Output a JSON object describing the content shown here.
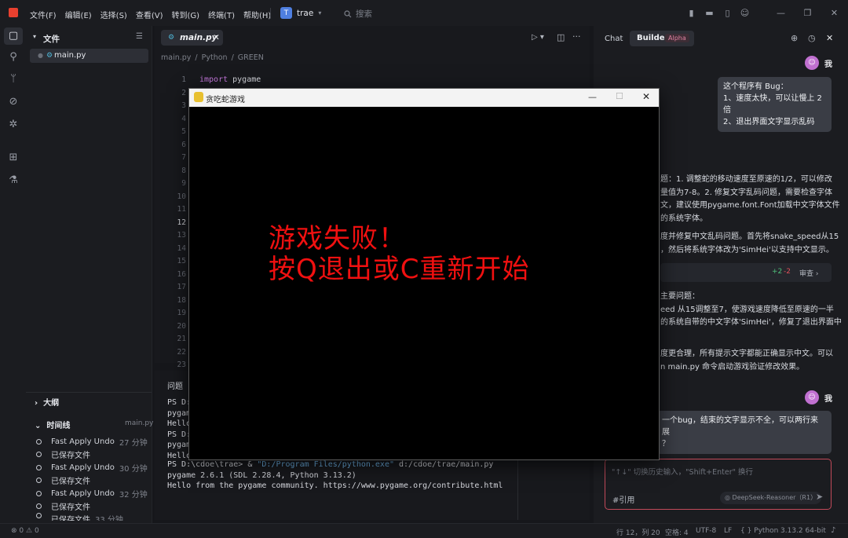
{
  "menu": [
    "文件(F)",
    "编辑(E)",
    "选择(S)",
    "查看(V)",
    "转到(G)",
    "终端(T)",
    "帮助(H)"
  ],
  "project": {
    "badge": "T",
    "name": "trae"
  },
  "search_placeholder": "搜索",
  "explorer": {
    "title": "文件",
    "file": "main.py",
    "outline": "大纲",
    "timeline": "时间线",
    "timeline_file": "main.py",
    "timeline_items": [
      {
        "label": "Fast Apply Undo",
        "time": "27 分钟"
      },
      {
        "label": "已保存文件",
        "time": ""
      },
      {
        "label": "Fast Apply Undo",
        "time": "30 分钟"
      },
      {
        "label": "已保存文件",
        "time": ""
      },
      {
        "label": "Fast Apply Undo",
        "time": "32 分钟"
      },
      {
        "label": "已保存文件",
        "time": ""
      },
      {
        "label": "已保存文件",
        "time": "33 分钟"
      }
    ]
  },
  "editor": {
    "tab": "main.py",
    "breadcrumb": [
      "main.py",
      "Python",
      "GREEN"
    ],
    "line_numbers": [
      "1",
      "2",
      "3",
      "4",
      "5",
      "6",
      "7",
      "8",
      "9",
      "10",
      "11",
      "12",
      "13",
      "14",
      "15",
      "16",
      "17",
      "18",
      "19",
      "20",
      "21",
      "22",
      "23"
    ],
    "code_line1_kw": "import",
    "code_line1_rest": " pygame"
  },
  "panel": {
    "tab": "问题",
    "term_lines": [
      "PS D:",
      "pygam",
      "Hello",
      "PS D:",
      "pygam",
      "Hello"
    ],
    "cmd_prefix": "PS D:\\cdoe\\trae> & ",
    "cmd_str": "\"D:/Program Files/python.exe\"",
    "cmd_rest": " d:/cdoe/trae/main.py",
    "out1": "pygame 2.6.1 (SDL 2.28.4, Python 3.13.2)",
    "out2": "Hello from the pygame community. https://www.pygame.org/contribute.html"
  },
  "chat": {
    "tab_chat": "Chat",
    "tab_builder": "Builder",
    "alpha": "Alpha",
    "me": "我",
    "user_msg1": [
      "这个程序有 Bug：",
      "1、速度太快，可以让慢上 2 倍",
      "2、退出界面文字显示乱码"
    ],
    "ai_lines": [
      "题：1. 调整蛇的移动速度至原速的1/2，可以修改",
      "量值为7-8。2. 修复文字乱码问题，需要检查字体",
      "文，建议使用pygame.font.Font加载中文字体文件",
      "的系统字体。"
    ],
    "ai_lines2": [
      "度并修复中文乱码问题。首先将snake_speed从15",
      "，然后将系统字体改为'SimHei'以支持中文显示。"
    ],
    "diff_add": "+2",
    "diff_del": "-2",
    "review": "审查",
    "summary_lines": [
      "主要问题：",
      "eed 从15调整至7，使游戏速度降低至原速的一半",
      "的系统自带的中文字体'SimHei'，修复了退出界面中"
    ],
    "summary2": [
      "度更合理，所有提示文字都能正确显示中文。可以",
      "n main.py 命令启动游戏验证修改效果。"
    ],
    "user_msg2": [
      "一个bug，结束的文字显示不全，可以两行来展",
      "？"
    ],
    "input_placeholder": "\"↑↓\" 切换历史输入，\"Shift+Enter\" 换行",
    "cite": "#引用",
    "model": "DeepSeek-Reasoner（R1）"
  },
  "status": {
    "errors": "0",
    "warnings": "0",
    "position": "行 12，列 20",
    "spaces": "空格: 4",
    "encoding": "UTF-8",
    "eol": "LF",
    "lang": "{ } Python",
    "version": "3.13.2 64-bit"
  },
  "game": {
    "title": "贪吃蛇游戏",
    "line1": "游戏失败！",
    "line2": "按Q退出或C重新开始",
    "text_color": "#f01010"
  }
}
